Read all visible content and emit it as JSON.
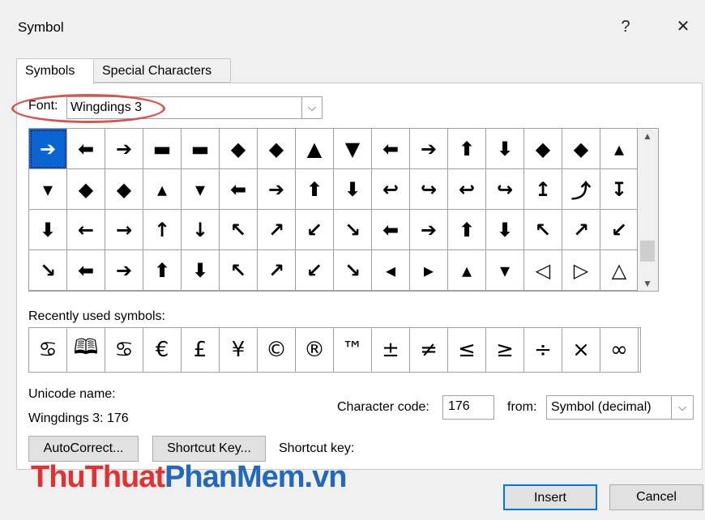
{
  "window": {
    "title": "Symbol",
    "help_glyph": "?",
    "close_glyph": "✕"
  },
  "tabs": [
    {
      "label": "Symbols",
      "active": true
    },
    {
      "label": "Special Characters",
      "active": false
    }
  ],
  "font": {
    "label": "Font:",
    "value": "Wingdings 3"
  },
  "symbol_grid": {
    "selected_index": 0,
    "rows": [
      [
        "➔",
        "⬅",
        "➔",
        "▬",
        "▬",
        "◆",
        "◆",
        "▲",
        "▼",
        "⬅",
        "➔",
        "⬆",
        "⬇",
        "◆",
        "◆",
        "▴"
      ],
      [
        "▾",
        "◆",
        "◆",
        "▴",
        "▾",
        "⬅",
        "➔",
        "⬆",
        "⬇",
        "↩",
        "↪",
        "↩",
        "↪",
        "↥",
        "⤴",
        "↧"
      ],
      [
        "⬇",
        "←",
        "→",
        "↑",
        "↓",
        "↖",
        "↗",
        "↙",
        "↘",
        "⬅",
        "➔",
        "⬆",
        "⬇",
        "↖",
        "↗",
        "↙"
      ],
      [
        "↘",
        "⬅",
        "➔",
        "⬆",
        "⬇",
        "↖",
        "↗",
        "↙",
        "↘",
        "◂",
        "▸",
        "▴",
        "▾",
        "◁",
        "▷",
        "△"
      ]
    ]
  },
  "recent": {
    "label": "Recently used symbols:",
    "symbols": [
      "♋",
      "🕮",
      "♋",
      "€",
      "£",
      "¥",
      "©",
      "®",
      "™",
      "±",
      "≠",
      "≤",
      "≥",
      "÷",
      "×",
      "∞"
    ]
  },
  "unicode": {
    "label": "Unicode name:",
    "value": "Wingdings 3: 176"
  },
  "character_code": {
    "label": "Character code:",
    "value": "176"
  },
  "from": {
    "label": "from:",
    "value": "Symbol (decimal)"
  },
  "buttons": {
    "autocorrect": "AutoCorrect...",
    "shortcut_key": "Shortcut Key...",
    "insert": "Insert",
    "cancel": "Cancel"
  },
  "shortcut_key_label": "Shortcut key:",
  "watermark": {
    "part1": "ThuThuat",
    "part2": "PhanMem",
    "part3": ".vn"
  }
}
